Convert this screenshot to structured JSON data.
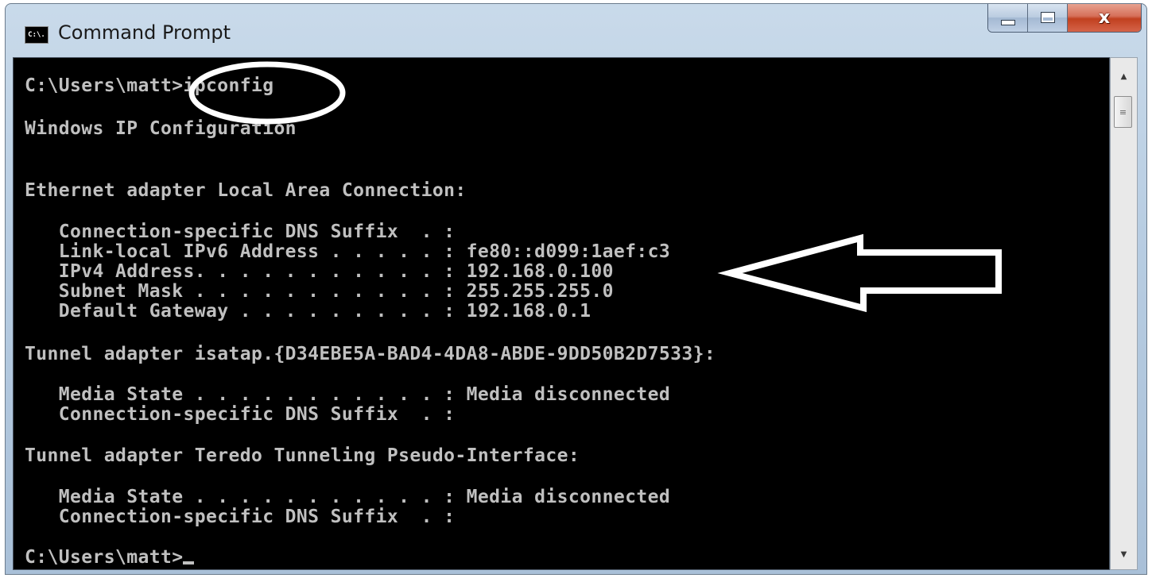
{
  "window": {
    "title": "Command Prompt",
    "icon_label": "C:\\.",
    "controls": {
      "minimize_icon": "minimize-icon",
      "maximize_icon": "maximize-icon",
      "close_icon": "close-icon",
      "close_glyph": "x"
    }
  },
  "console": {
    "prompt_command": "C:\\Users\\matt>ipconfig",
    "header": "Windows IP Configuration",
    "ethernet_header": "Ethernet adapter Local Area Connection:",
    "ethernet_lines": [
      "   Connection-specific DNS Suffix  . :",
      "   Link-local IPv6 Address . . . . . : fe80::d099:1aef:c3",
      "   IPv4 Address. . . . . . . . . . . : 192.168.0.100",
      "   Subnet Mask . . . . . . . . . . . : 255.255.255.0",
      "   Default Gateway . . . . . . . . . : 192.168.0.1"
    ],
    "isatap_header": "Tunnel adapter isatap.{D34EBE5A-BAD4-4DA8-ABDE-9DD50B2D7533}:",
    "isatap_lines": [
      "   Media State . . . . . . . . . . . : Media disconnected",
      "   Connection-specific DNS Suffix  . :"
    ],
    "teredo_header": "Tunnel adapter Teredo Tunneling Pseudo-Interface:",
    "teredo_lines": [
      "   Media State . . . . . . . . . . . : Media disconnected",
      "   Connection-specific DNS Suffix  . :"
    ],
    "final_prompt": "C:\\Users\\matt>"
  },
  "scrollbar": {
    "up_icon": "scroll-up-arrow-icon",
    "down_icon": "scroll-down-arrow-icon",
    "up_glyph": "▲",
    "down_glyph": "▼",
    "thumb_glyph": "≡"
  },
  "colors": {
    "console_background": "#000000",
    "console_text": "#c0c0c0",
    "annotation": "#ffffff",
    "close_button": "#c1401f"
  }
}
